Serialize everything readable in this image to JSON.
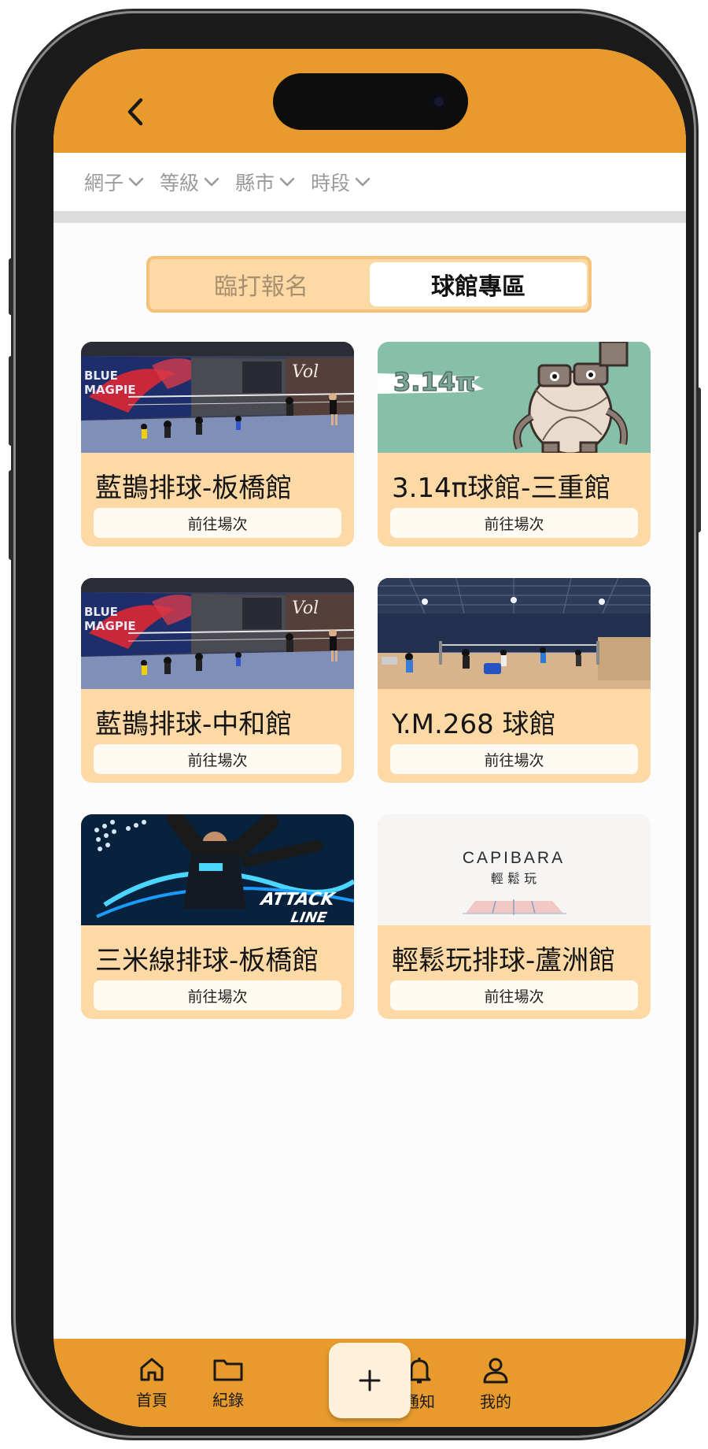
{
  "header": {
    "back_icon": "chevron-left-icon"
  },
  "filters": [
    {
      "label": "網子"
    },
    {
      "label": "等級"
    },
    {
      "label": "縣市"
    },
    {
      "label": "時段"
    }
  ],
  "segment": {
    "left": "臨打報名",
    "right": "球館專區",
    "active": "right"
  },
  "venues": [
    {
      "name": "藍鵲排球-板橋館",
      "button": "前往場次"
    },
    {
      "name": "3.14π球館-三重館",
      "button": "前往場次"
    },
    {
      "name": "藍鵲排球-中和館",
      "button": "前往場次"
    },
    {
      "name": "Y.M.268 球館",
      "button": "前往場次"
    },
    {
      "name": "三米線排球-板橋館",
      "button": "前往場次"
    },
    {
      "name": "輕鬆玩排球-蘆洲館",
      "button": "前往場次"
    }
  ],
  "images": {
    "bluemagpie_text1": "BLUE",
    "bluemagpie_text2": "MAGPIE",
    "bluemagpie_vol": "Vol",
    "pi_text": "3.14π",
    "attack_text1": "ATTACK",
    "attack_text2": "LINE",
    "capibara_text": "CAPIBARA",
    "capibara_sub": "輕 鬆 玩"
  },
  "tabbar": {
    "home": "首頁",
    "records": "紀錄",
    "add_icon": "plus-icon",
    "notify": "通知",
    "profile": "我的"
  },
  "colors": {
    "primary": "#e89b2c",
    "card_bg": "#fdd9a6",
    "button_bg": "#fffaf2"
  }
}
